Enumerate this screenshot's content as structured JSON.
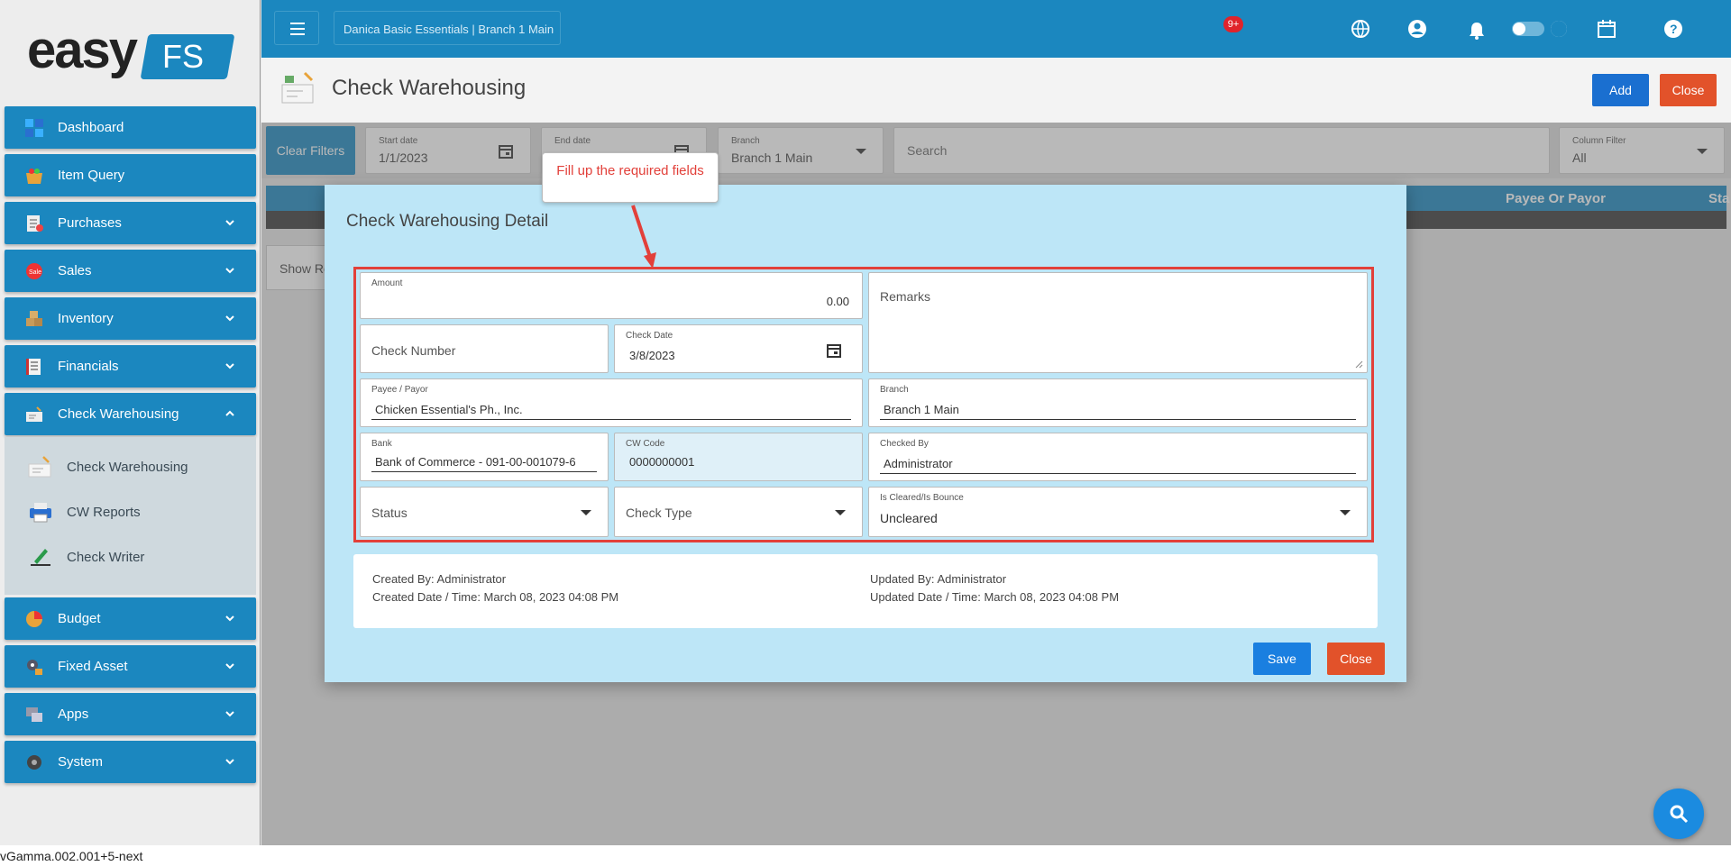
{
  "app": {
    "brand_left": "easy",
    "brand_right": "FS",
    "version": "vGamma.002.001+5-next"
  },
  "sidebar": {
    "items": [
      {
        "label": "Dashboard"
      },
      {
        "label": "Item Query"
      },
      {
        "label": "Purchases"
      },
      {
        "label": "Sales"
      },
      {
        "label": "Inventory"
      },
      {
        "label": "Financials"
      },
      {
        "label": "Check Warehousing"
      },
      {
        "label": "Budget"
      },
      {
        "label": "Fixed Asset"
      },
      {
        "label": "Apps"
      },
      {
        "label": "System"
      }
    ],
    "sub_items": [
      {
        "label": "Check Warehousing"
      },
      {
        "label": "CW Reports"
      },
      {
        "label": "Check Writer"
      }
    ]
  },
  "topbar": {
    "breadcrumb": "Danica Basic Essentials | Branch 1 Main",
    "notification_count": "9+"
  },
  "page": {
    "title": "Check Warehousing",
    "add_label": "Add",
    "close_label": "Close"
  },
  "filters": {
    "clear_label": "Clear Filters",
    "start_date_label": "Start date",
    "start_date": "1/1/2023",
    "end_date_label": "End date",
    "end_date": "",
    "branch_label": "Branch",
    "branch": "Branch 1 Main",
    "search_placeholder": "Search",
    "column_filter_label": "Column Filter",
    "column_filter": "All"
  },
  "grid": {
    "col_payee": "Payee Or Payor",
    "col_next": "Sta",
    "show_rows": "Show Ro"
  },
  "modal": {
    "title": "Check Warehousing Detail",
    "callout": "Fill up the required fields",
    "amount_label": "Amount",
    "amount": "0.00",
    "remarks_placeholder": "Remarks",
    "check_number_placeholder": "Check Number",
    "check_date_label": "Check Date",
    "check_date": "3/8/2023",
    "payee_label": "Payee / Payor",
    "payee": "Chicken Essential's Ph., Inc.",
    "branch_label": "Branch",
    "branch": "Branch 1 Main",
    "bank_label": "Bank",
    "bank": "Bank of Commerce - 091-00-001079-6",
    "cw_code_label": "CW Code",
    "cw_code": "0000000001",
    "checked_by_label": "Checked By",
    "checked_by": "Administrator",
    "status_placeholder": "Status",
    "check_type_placeholder": "Check Type",
    "cleared_label": "Is Cleared/Is Bounce",
    "cleared": "Uncleared",
    "created_by": "Created By: Administrator",
    "created_date": "Created Date / Time: March 08, 2023 04:08 PM",
    "updated_by": "Updated By: Administrator",
    "updated_date": "Updated Date / Time: March 08, 2023 04:08 PM",
    "save_label": "Save",
    "close_label": "Close"
  },
  "colors": {
    "primary": "#1b87bf",
    "danger": "#e2522a",
    "modal_bg": "#bde6f7",
    "highlight": "#e2403a",
    "save": "#1a7fe0"
  },
  "icons": [
    "menu-icon",
    "globe-icon",
    "user-icon",
    "bell-icon",
    "toggle-icon",
    "moon-icon",
    "calendar-icon",
    "help-icon",
    "search-icon"
  ]
}
